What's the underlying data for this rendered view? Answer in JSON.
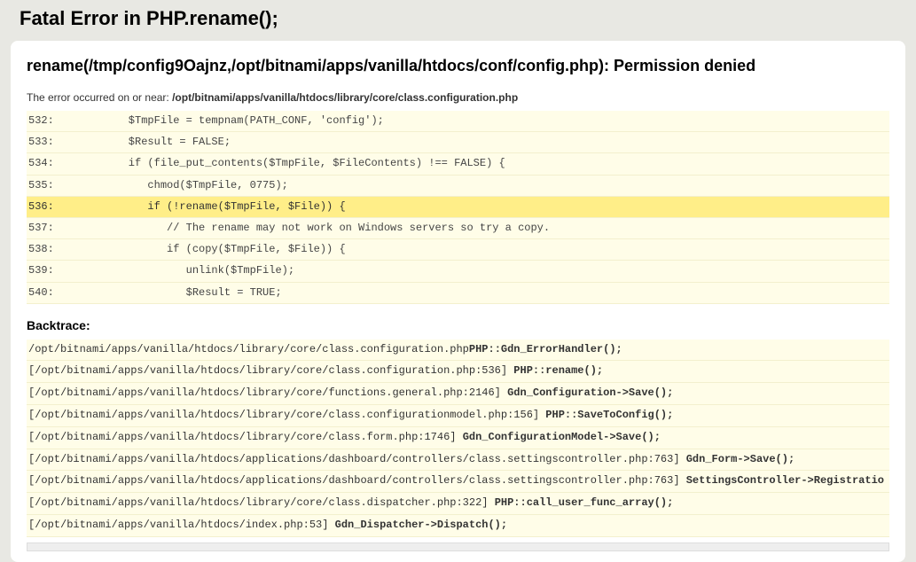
{
  "page_title": "Fatal Error in PHP.rename();",
  "error_heading": "rename(/tmp/config9Oajnz,/opt/bitnami/apps/vanilla/htdocs/conf/config.php): Permission denied",
  "location_prefix": "The error occurred on or near: ",
  "location_path": "/opt/bitnami/apps/vanilla/htdocs/library/core/class.configuration.php",
  "code_lines": [
    {
      "no": "532:",
      "text": "         $TmpFile = tempnam(PATH_CONF, 'config');",
      "hl": false
    },
    {
      "no": "533:",
      "text": "         $Result = FALSE;",
      "hl": false
    },
    {
      "no": "534:",
      "text": "         if (file_put_contents($TmpFile, $FileContents) !== FALSE) {",
      "hl": false
    },
    {
      "no": "535:",
      "text": "            chmod($TmpFile, 0775);",
      "hl": false
    },
    {
      "no": "536:",
      "text": "            if (!rename($TmpFile, $File)) {",
      "hl": true
    },
    {
      "no": "537:",
      "text": "               // The rename may not work on Windows servers so try a copy.",
      "hl": false
    },
    {
      "no": "538:",
      "text": "               if (copy($TmpFile, $File)) {",
      "hl": false
    },
    {
      "no": "539:",
      "text": "                  unlink($TmpFile);",
      "hl": false
    },
    {
      "no": "540:",
      "text": "                  $Result = TRUE;",
      "hl": false
    }
  ],
  "backtrace_heading": "Backtrace:",
  "backtrace": [
    {
      "loc": "/opt/bitnami/apps/vanilla/htdocs/library/core/class.configuration.php",
      "call": "PHP::Gdn_ErrorHandler();"
    },
    {
      "loc": "[/opt/bitnami/apps/vanilla/htdocs/library/core/class.configuration.php:536] ",
      "call": "PHP::rename();"
    },
    {
      "loc": "[/opt/bitnami/apps/vanilla/htdocs/library/core/functions.general.php:2146] ",
      "call": "Gdn_Configuration->Save();"
    },
    {
      "loc": "[/opt/bitnami/apps/vanilla/htdocs/library/core/class.configurationmodel.php:156] ",
      "call": "PHP::SaveToConfig();"
    },
    {
      "loc": "[/opt/bitnami/apps/vanilla/htdocs/library/core/class.form.php:1746] ",
      "call": "Gdn_ConfigurationModel->Save();"
    },
    {
      "loc": "[/opt/bitnami/apps/vanilla/htdocs/applications/dashboard/controllers/class.settingscontroller.php:763] ",
      "call": "Gdn_Form->Save();"
    },
    {
      "loc": "[/opt/bitnami/apps/vanilla/htdocs/applications/dashboard/controllers/class.settingscontroller.php:763] ",
      "call": "SettingsController->Registratio"
    },
    {
      "loc": "[/opt/bitnami/apps/vanilla/htdocs/library/core/class.dispatcher.php:322] ",
      "call": "PHP::call_user_func_array();"
    },
    {
      "loc": "[/opt/bitnami/apps/vanilla/htdocs/index.php:53] ",
      "call": "Gdn_Dispatcher->Dispatch();"
    }
  ]
}
